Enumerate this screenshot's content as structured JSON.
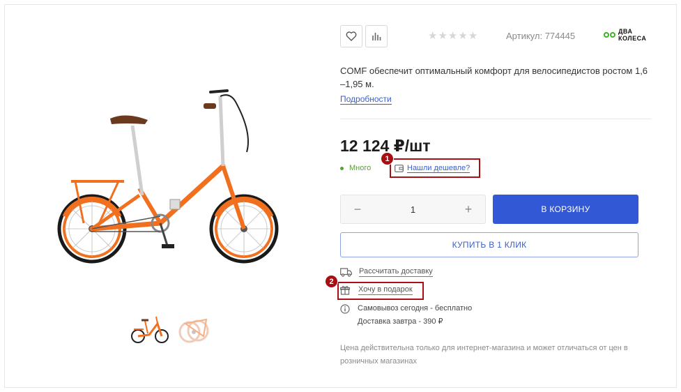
{
  "product": {
    "rating_stars": "★★★★★",
    "article_label": "Артикул: 774445",
    "brand_line1": "ДВА",
    "brand_line2": "КОЛЕСА",
    "description": "COMF обеспечит оптимальный комфорт для велосипедистов ростом 1,6 –1,95 м.",
    "details_link": "Подробности",
    "price": "12 124 ₽/шт",
    "stock": "Много",
    "cheaper_link": "Нашли дешевле?",
    "quantity": "1",
    "qty_minus": "−",
    "qty_plus": "+",
    "cart_button": "В КОРЗИНУ",
    "one_click_button": "КУПИТЬ В 1 КЛИК",
    "delivery_link": "Рассчитать доставку",
    "gift_link": "Хочу в подарок",
    "pickup_line1": "Самовывоз сегодня - бесплатно",
    "pickup_line2": "Доставка завтра - 390 ₽",
    "price_note": "Цена действительна только для интернет-магазина и может отличаться от цен в розничных магазинах"
  },
  "annotations": {
    "badge_1": "1",
    "badge_2": "2"
  },
  "colors": {
    "accent_blue": "#3258d6",
    "link_blue": "#3a5fc8",
    "stock_green": "#58a234",
    "highlight_red": "#a80e12",
    "bike_orange": "#f07020"
  },
  "icons": [
    "heart-icon",
    "compare-chart-icon",
    "star-icon",
    "wallet-icon",
    "truck-icon",
    "gift-icon",
    "info-icon"
  ]
}
